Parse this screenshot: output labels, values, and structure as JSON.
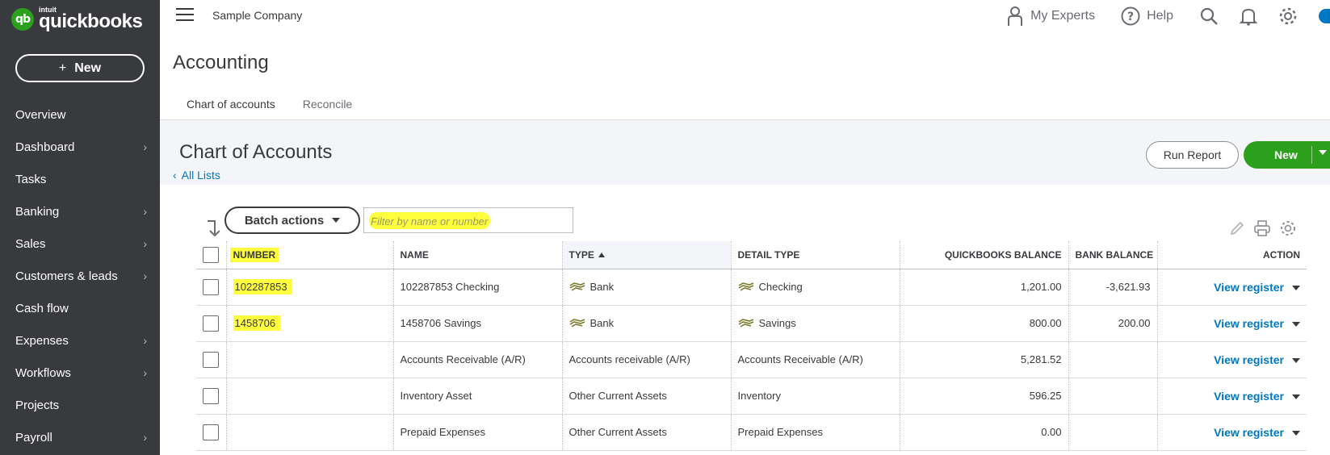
{
  "brand": {
    "intuit": "intuit",
    "name": "quickbooks",
    "mark": "qb"
  },
  "sidebar": {
    "new_label": "New",
    "items": [
      {
        "label": "Overview",
        "chevron": false
      },
      {
        "label": "Dashboard",
        "chevron": true
      },
      {
        "label": "Tasks",
        "chevron": false
      },
      {
        "label": "Banking",
        "chevron": true
      },
      {
        "label": "Sales",
        "chevron": true
      },
      {
        "label": "Customers & leads",
        "chevron": true
      },
      {
        "label": "Cash flow",
        "chevron": false
      },
      {
        "label": "Expenses",
        "chevron": true
      },
      {
        "label": "Workflows",
        "chevron": true
      },
      {
        "label": "Projects",
        "chevron": false
      },
      {
        "label": "Payroll",
        "chevron": true
      }
    ]
  },
  "topbar": {
    "company": "Sample Company",
    "my_experts": "My Experts",
    "help": "Help"
  },
  "page": {
    "title": "Accounting",
    "tabs": [
      {
        "label": "Chart of accounts",
        "active": true
      },
      {
        "label": "Reconcile",
        "active": false
      }
    ]
  },
  "section": {
    "title": "Chart of Accounts",
    "all_lists": "All Lists",
    "run_report": "Run Report",
    "new": "New"
  },
  "table_tools": {
    "batch_actions": "Batch actions",
    "filter_placeholder": "Filter by name or number"
  },
  "table": {
    "columns": {
      "number": "NUMBER",
      "name": "NAME",
      "type": "TYPE",
      "detail_type": "DETAIL TYPE",
      "qb_balance": "QUICKBOOKS BALANCE",
      "bank_balance": "BANK BALANCE",
      "action": "ACTION"
    },
    "rows": [
      {
        "number": "102287853",
        "name": "102287853 Checking",
        "type": "Bank",
        "detail_type": "Checking",
        "qb_balance": "1,201.00",
        "bank_balance": "-3,621.93",
        "action": "View register",
        "bank_icon": true
      },
      {
        "number": "1458706",
        "name": "1458706 Savings",
        "type": "Bank",
        "detail_type": "Savings",
        "qb_balance": "800.00",
        "bank_balance": "200.00",
        "action": "View register",
        "bank_icon": true
      },
      {
        "number": "",
        "name": "Accounts Receivable (A/R)",
        "type": "Accounts receivable (A/R)",
        "detail_type": "Accounts Receivable (A/R)",
        "qb_balance": "5,281.52",
        "bank_balance": "",
        "action": "View register",
        "bank_icon": false
      },
      {
        "number": "",
        "name": "Inventory Asset",
        "type": "Other Current Assets",
        "detail_type": "Inventory",
        "qb_balance": "596.25",
        "bank_balance": "",
        "action": "View register",
        "bank_icon": false
      },
      {
        "number": "",
        "name": "Prepaid Expenses",
        "type": "Other Current Assets",
        "detail_type": "Prepaid Expenses",
        "qb_balance": "0.00",
        "bank_balance": "",
        "action": "View register",
        "bank_icon": false
      }
    ]
  },
  "colors": {
    "sidebar_bg": "#393a3d",
    "brand_green": "#2ca01c",
    "link_blue": "#0077c5",
    "highlight_yellow": "#ffff3d",
    "section_bg": "#f4f5f8"
  }
}
